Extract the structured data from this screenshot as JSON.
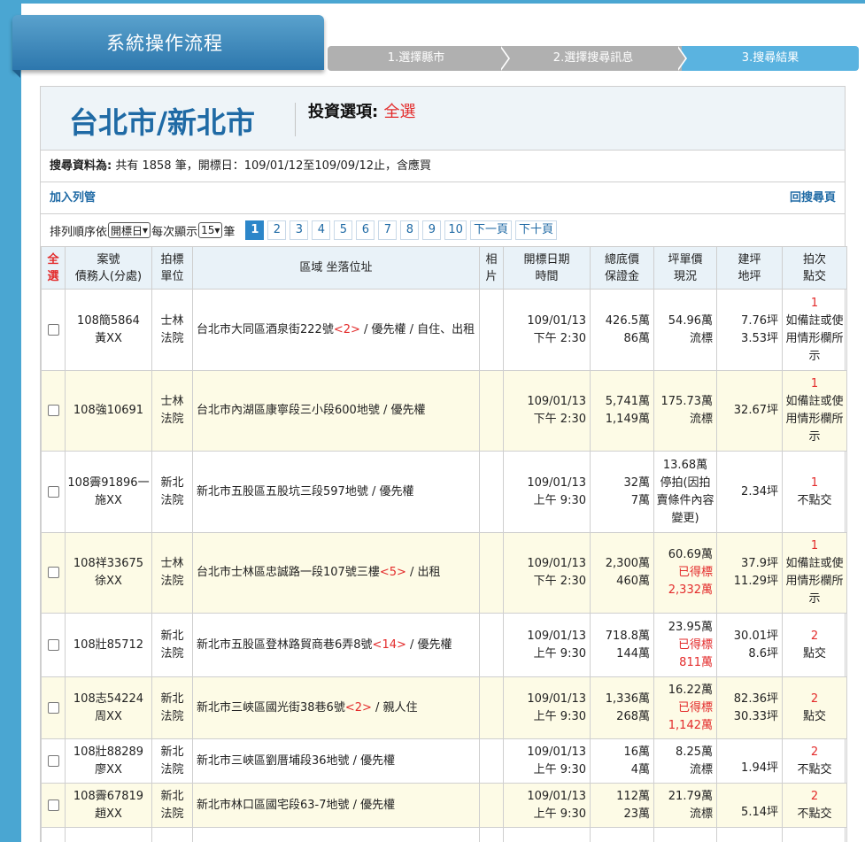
{
  "header": {
    "title": "系統操作流程",
    "steps": [
      "1.選擇縣市",
      "2.選擇搜尋訊息",
      "3.搜尋結果"
    ]
  },
  "region": {
    "name": "台北市/新北市",
    "invest_label": "投資選項:",
    "invest_value": "全選"
  },
  "summary": {
    "label": "搜尋資料為:",
    "text": "共有 1858 筆，開標日：109/01/12至109/09/12止，含應買"
  },
  "actions": {
    "add_watch": "加入列管",
    "back_search": "回搜尋頁"
  },
  "toolbar": {
    "sort_label": "排列順序依",
    "sort_value": "開標日",
    "per_page_label": "每次顯示",
    "per_page_value": "15",
    "per_page_unit": "筆",
    "pages": [
      "1",
      "2",
      "3",
      "4",
      "5",
      "6",
      "7",
      "8",
      "9",
      "10"
    ],
    "next_page": "下一頁",
    "next_ten": "下十頁"
  },
  "table": {
    "headers": {
      "select_all_1": "全",
      "select_all_2": "選",
      "case_1": "案號",
      "case_2": "債務人(分處)",
      "court_1": "拍標",
      "court_2": "單位",
      "address": "區域 坐落位址",
      "photo_1": "相",
      "photo_2": "片",
      "date_1": "開標日期",
      "date_2": "時間",
      "price_1": "總底價",
      "price_2": "保證金",
      "unit_1": "坪單價",
      "unit_2": "現況",
      "area_1": "建坪",
      "area_2": "地坪",
      "round_1": "拍次",
      "round_2": "點交"
    },
    "rows": [
      {
        "case": "108簡5864",
        "debtor": "黃XX",
        "court1": "士林",
        "court2": "法院",
        "addr_pre": "台北市大同區酒泉街222號",
        "addr_red": "<2>",
        "addr_post": " / 優先權 / 自住、出租",
        "date": "109/01/13",
        "time": "下午 2:30",
        "price": "426.5萬",
        "deposit": "86萬",
        "unit_price": "54.96萬",
        "status": "流標",
        "status_red": "",
        "bld": "7.76坪",
        "land": "3.53坪",
        "round": "1",
        "delivery": "如備註或使用情形欄所示"
      },
      {
        "case": "108強10691",
        "debtor": "",
        "court1": "士林",
        "court2": "法院",
        "addr_pre": "台北市內湖區康寧段三小段600地號 / 優先權",
        "addr_red": "",
        "addr_post": "",
        "date": "109/01/13",
        "time": "下午 2:30",
        "price": "5,741萬",
        "deposit": "1,149萬",
        "unit_price": "175.73萬",
        "status": "流標",
        "status_red": "",
        "bld": "",
        "land": "32.67坪",
        "round": "1",
        "delivery": "如備註或使用情形欄所示"
      },
      {
        "case": "108霽91896一",
        "debtor": "施XX",
        "court1": "新北",
        "court2": "法院",
        "addr_pre": "新北市五股區五股坑三段597地號 / 優先權",
        "addr_red": "",
        "addr_post": "",
        "date": "109/01/13",
        "time": "上午 9:30",
        "price": "32萬",
        "deposit": "7萬",
        "unit_price": "13.68萬",
        "status": "停拍(因拍賣條件內容變更)",
        "status_red": "",
        "bld": "",
        "land": "2.34坪",
        "round": "1",
        "delivery": "不點交"
      },
      {
        "case": "108祥33675",
        "debtor": "徐XX",
        "court1": "士林",
        "court2": "法院",
        "addr_pre": "台北市士林區忠誠路一段107號三樓",
        "addr_red": "<5>",
        "addr_post": " / 出租",
        "date": "109/01/13",
        "time": "下午 2:30",
        "price": "2,300萬",
        "deposit": "460萬",
        "unit_price": "60.69萬",
        "status": "已得標",
        "status_red": "2,332萬",
        "bld": "37.9坪",
        "land": "11.29坪",
        "round": "1",
        "delivery": "如備註或使用情形欄所示"
      },
      {
        "case": "108壯85712",
        "debtor": "",
        "court1": "新北",
        "court2": "法院",
        "addr_pre": "新北市五股區登林路貿商巷6弄8號",
        "addr_red": "<14>",
        "addr_post": " / 優先權",
        "date": "109/01/13",
        "time": "上午 9:30",
        "price": "718.8萬",
        "deposit": "144萬",
        "unit_price": "23.95萬",
        "status": "已得標",
        "status_red": "811萬",
        "bld": "30.01坪",
        "land": "8.6坪",
        "round": "2",
        "delivery": "點交"
      },
      {
        "case": "108志54224",
        "debtor": "周XX",
        "court1": "新北",
        "court2": "法院",
        "addr_pre": "新北市三峽區國光街38巷6號",
        "addr_red": "<2>",
        "addr_post": " / 親人住",
        "date": "109/01/13",
        "time": "上午 9:30",
        "price": "1,336萬",
        "deposit": "268萬",
        "unit_price": "16.22萬",
        "status": "已得標",
        "status_red": "1,142萬",
        "bld": "82.36坪",
        "land": "30.33坪",
        "round": "2",
        "delivery": "點交"
      },
      {
        "case": "108壯88289",
        "debtor": "廖XX",
        "court1": "新北",
        "court2": "法院",
        "addr_pre": "新北市三峽區劉厝埔段36地號 / 優先權",
        "addr_red": "",
        "addr_post": "",
        "date": "109/01/13",
        "time": "上午 9:30",
        "price": "16萬",
        "deposit": "4萬",
        "unit_price": "8.25萬",
        "status": "流標",
        "status_red": "",
        "bld": "",
        "land": "1.94坪",
        "round": "2",
        "delivery": "不點交"
      },
      {
        "case": "108霽67819",
        "debtor": "趙XX",
        "court1": "新北",
        "court2": "法院",
        "addr_pre": "新北市林口區國宅段63-7地號 / 優先權",
        "addr_red": "",
        "addr_post": "",
        "date": "109/01/13",
        "time": "上午 9:30",
        "price": "112萬",
        "deposit": "23萬",
        "unit_price": "21.79萬",
        "status": "流標",
        "status_red": "",
        "bld": "",
        "land": "5.14坪",
        "round": "2",
        "delivery": "不點交"
      }
    ]
  },
  "colors": {
    "brand": "#2d77ad",
    "accent_red": "#e32b2b",
    "active_step": "#5ab3e0",
    "page_active": "#2c86c9"
  }
}
